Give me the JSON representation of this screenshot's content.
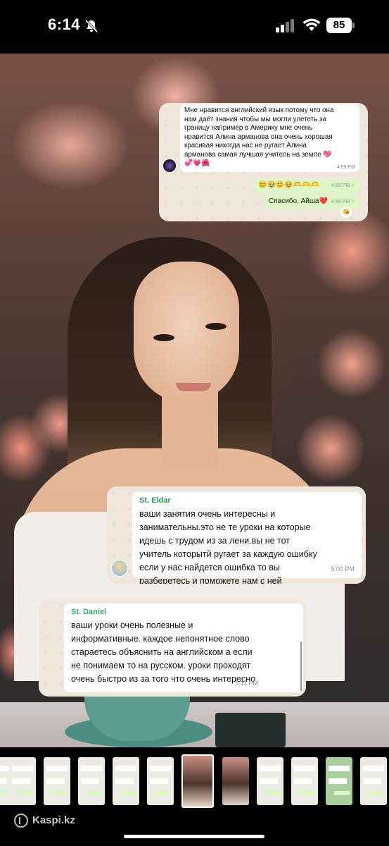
{
  "status_bar": {
    "time": "6:14",
    "battery": "85",
    "icons": [
      "bell-slash-icon",
      "cellular-signal-icon",
      "wifi-icon",
      "battery-icon"
    ]
  },
  "photo": {
    "description_icons": [
      "woman-portrait",
      "pink-roses",
      "teal-cup"
    ]
  },
  "card1": {
    "message1": {
      "text": "Мне нравится английский язык потому что она нам даёт знания чтобы мы могли улететь за границу например в Америку мне очень нравится Алина арманова она очень хорошая красивая никогда нас не  ругает Алина арманова самая лучшая  учитель на земле 💖💞💗🌺",
      "time": "4:59 PM"
    },
    "message2": {
      "text": "😊🥹😊🥹🫶🫶🫶",
      "time": "4:59 PM"
    },
    "message3": {
      "text": "Спасибо, Айша❤️",
      "time": "4:59 PM"
    },
    "reaction": "😘"
  },
  "card2": {
    "sender": "St. Eldar",
    "text": "ваши занятия очень интересны и занимательны.это не те уроки на которые идешь с трудом из за лени.вы не тот учитель которытй ругает за каждую ошибку если у нас найдется ошибка то вы разберетесь и поможете нам с ней",
    "time": "5:00 PM"
  },
  "card3": {
    "sender": "St. Daniel",
    "text": "ваши уроки очень полезные и информативные. каждое непонятное слово стараетесь объяснить на английском а если не понимаем то на русском. уроки проходят очень быстро из за того что очень интересно",
    "time": "5:11 PM"
  },
  "footer": {
    "brand": "Kaspi.kz"
  },
  "colors": {
    "incoming_bubble": "#ffffff",
    "outgoing_bubble": "#dcf8c6",
    "chat_background": "#efe6dc",
    "eldar_name": "#2e9e5b",
    "daniel_name": "#34b36e"
  }
}
